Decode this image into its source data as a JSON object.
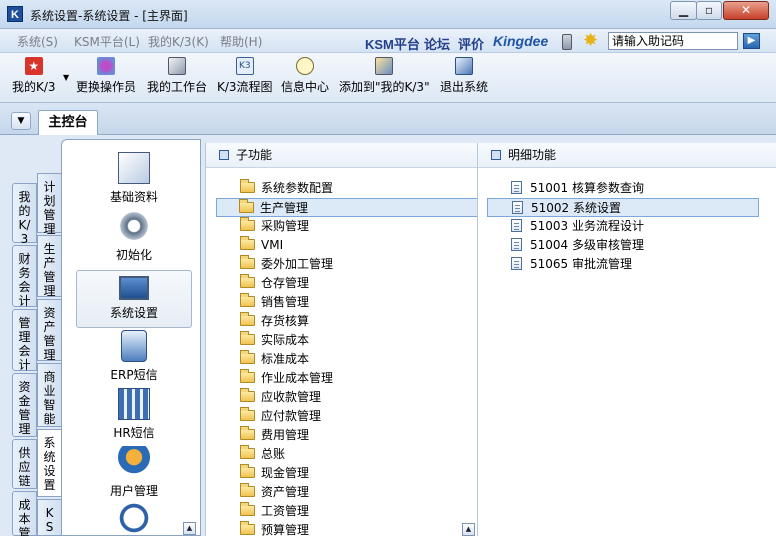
{
  "window": {
    "title": "系统设置-系统设置 - [主界面]"
  },
  "menu": {
    "items": [
      "系统(S)",
      "KSM平台(L)",
      "我的K/3(K)",
      "帮助(H)"
    ],
    "links": [
      "KSM平台",
      "论坛",
      "评价"
    ],
    "brand": "Kingdee",
    "search_placeholder": "请输入助记码"
  },
  "toolbar": {
    "items": [
      "我的K/3",
      "更换操作员",
      "我的工作台",
      "K/3流程图",
      "信息中心",
      "添加到\"我的K/3\"",
      "退出系统"
    ]
  },
  "tabs": {
    "main": "主控台"
  },
  "left_tabs": {
    "outer": [
      "我的K/3",
      "财务会计",
      "管理会计",
      "资金管理",
      "供应链",
      "成本管"
    ],
    "inner": [
      "计划管理",
      "生产管理",
      "资产管理",
      "商业智能",
      "系统设置",
      "KSM"
    ]
  },
  "modules": [
    "基础资料",
    "初始化",
    "系统设置",
    "ERP短信",
    "HR短信",
    "用户管理"
  ],
  "subfunctions": {
    "header": "子功能",
    "items": [
      "系统参数配置",
      "生产管理",
      "采购管理",
      "VMI",
      "委外加工管理",
      "仓存管理",
      "销售管理",
      "存货核算",
      "实际成本",
      "标准成本",
      "作业成本管理",
      "应收款管理",
      "应付款管理",
      "费用管理",
      "总账",
      "现金管理",
      "资产管理",
      "工资管理",
      "预算管理"
    ],
    "selected_index": 1
  },
  "details": {
    "header": "明细功能",
    "items": [
      {
        "code": "51001",
        "name": "核算参数查询"
      },
      {
        "code": "51002",
        "name": "系统设置"
      },
      {
        "code": "51003",
        "name": "业务流程设计"
      },
      {
        "code": "51004",
        "name": "多级审核管理"
      },
      {
        "code": "51065",
        "name": "审批流管理"
      }
    ],
    "selected_index": 1
  },
  "colors": {
    "accent": "#1e55a8",
    "selection": "#dceaf8",
    "selection_border": "#7da7d9",
    "panel_bg": "#dfe9f5"
  },
  "icons": [
    "k3-logo-icon",
    "minimize-icon",
    "maximize-icon",
    "close-icon",
    "phone-icon",
    "star-icon",
    "go-arrow-icon",
    "my-k3-icon",
    "change-user-icon",
    "workbench-icon",
    "flowchart-icon",
    "message-icon",
    "add-favorite-icon",
    "exit-icon",
    "folder-icon",
    "document-icon"
  ]
}
